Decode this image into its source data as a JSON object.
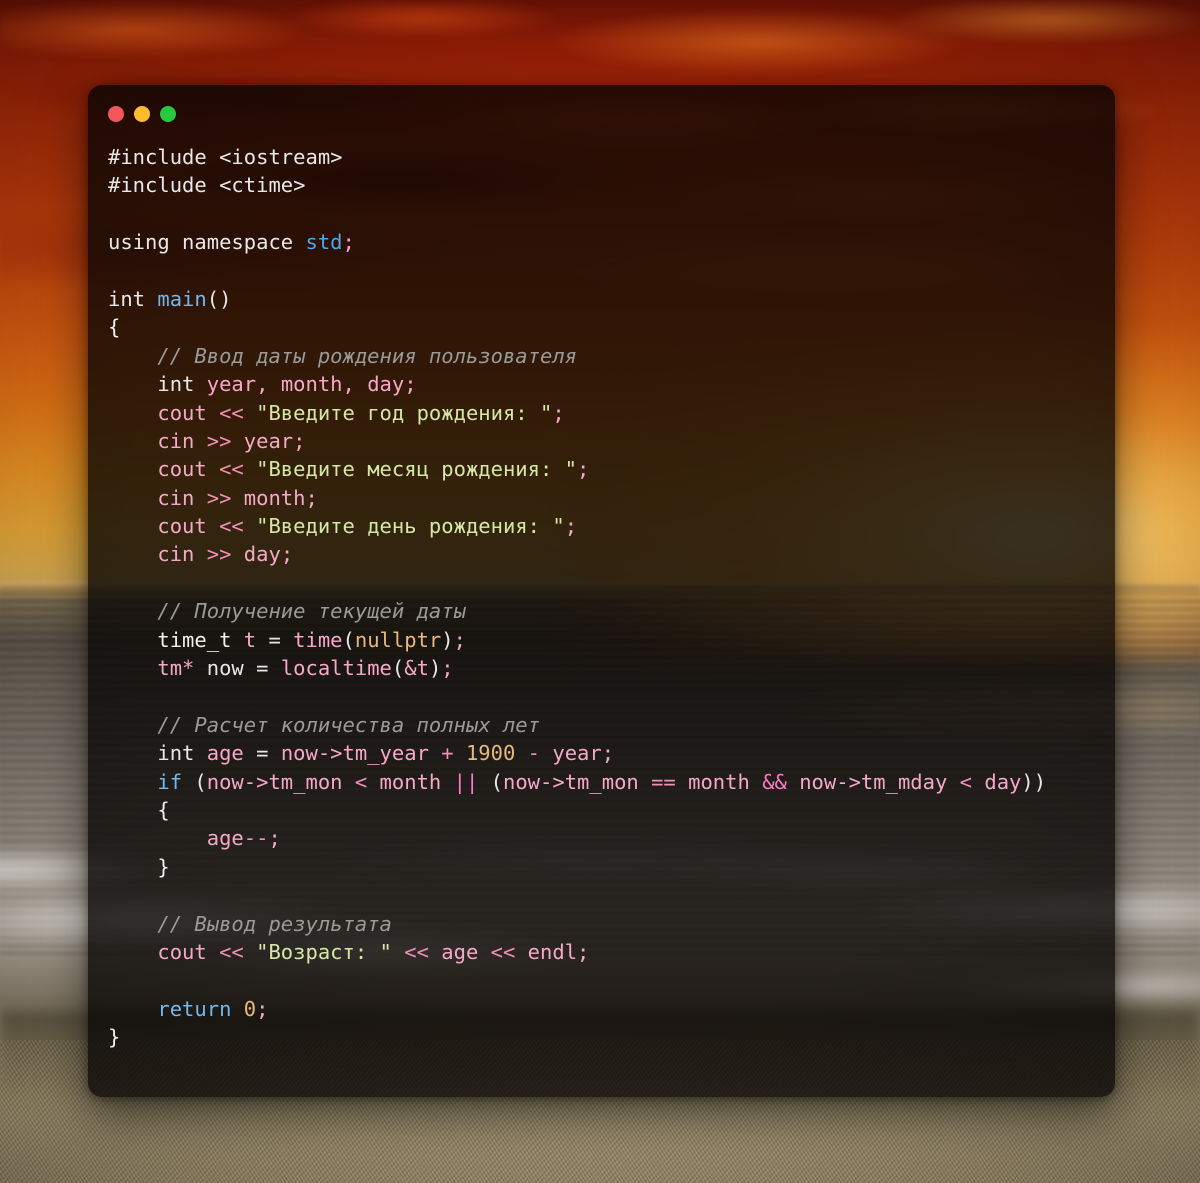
{
  "window": {
    "title": "",
    "traffic_lights": [
      {
        "name": "close",
        "color": "#f2575c"
      },
      {
        "name": "minimize",
        "color": "#fdbc2e"
      },
      {
        "name": "maximize",
        "color": "#28c840"
      }
    ]
  },
  "theme": {
    "background_color": "#080504",
    "plain": "#e8e8e8",
    "control_keyword": "#72b8ef",
    "namespace": "#4ea6ef",
    "function": "#6fb7ee",
    "variable": "#f7a8c8",
    "string": "#d7e8a6",
    "comment": "#9a9a9a",
    "number": "#e8b97a",
    "operator": "#f48fb8",
    "operator_bold": "#ff79c6"
  },
  "wallpaper": {
    "description": "sunset beach with red sky, ocean surf and sand",
    "sky_top_color": "#6b1205",
    "sky_glow_color": "#ffd27a",
    "sand_color": "#a4946d",
    "foam_color": "#f4f2ee"
  },
  "code": {
    "language": "C++",
    "lines": [
      "#include <iostream>",
      "#include <ctime>",
      "",
      "using namespace std;",
      "",
      "int main()",
      "{",
      "    // Ввод даты рождения пользователя",
      "    int year, month, day;",
      "    cout << \"Введите год рождения: \";",
      "    cin >> year;",
      "    cout << \"Введите месяц рождения: \";",
      "    cin >> month;",
      "    cout << \"Введите день рождения: \";",
      "    cin >> day;",
      "",
      "    // Получение текущей даты",
      "    time_t t = time(nullptr);",
      "    tm* now = localtime(&t);",
      "",
      "    // Расчет количества полных лет",
      "    int age = now->tm_year + 1900 - year;",
      "    if (now->tm_mon < month || (now->tm_mon == month && now->tm_mday < day))",
      "    {",
      "        age--;",
      "    }",
      "",
      "    // Вывод результата",
      "    cout << \"Возраст: \" << age << endl;",
      "",
      "    return 0;",
      "}"
    ],
    "tokens": [
      [
        {
          "c": "t-pre",
          "t": "#include "
        },
        {
          "c": "t-plain",
          "t": "<iostream>"
        }
      ],
      [
        {
          "c": "t-pre",
          "t": "#include "
        },
        {
          "c": "t-plain",
          "t": "<ctime>"
        }
      ],
      [],
      [
        {
          "c": "t-plain",
          "t": "using namespace "
        },
        {
          "c": "t-ns",
          "t": "std"
        },
        {
          "c": "t-punc",
          "t": ";"
        }
      ],
      [],
      [
        {
          "c": "t-plain",
          "t": "int "
        },
        {
          "c": "t-fn",
          "t": "main"
        },
        {
          "c": "t-plain",
          "t": "()"
        }
      ],
      [
        {
          "c": "t-brace",
          "t": "{"
        }
      ],
      [
        {
          "c": "t-cmt",
          "t": "    // Ввод даты рождения пользователя"
        }
      ],
      [
        {
          "c": "t-plain",
          "t": "    int "
        },
        {
          "c": "t-var",
          "t": "year"
        },
        {
          "c": "t-punc",
          "t": ", "
        },
        {
          "c": "t-var",
          "t": "month"
        },
        {
          "c": "t-punc",
          "t": ", "
        },
        {
          "c": "t-var",
          "t": "day"
        },
        {
          "c": "t-punc",
          "t": ";"
        }
      ],
      [
        {
          "c": "t-call",
          "t": "    cout "
        },
        {
          "c": "t-op",
          "t": "<< "
        },
        {
          "c": "t-str",
          "t": "\"Введите год рождения: \""
        },
        {
          "c": "t-punc",
          "t": ";"
        }
      ],
      [
        {
          "c": "t-call",
          "t": "    cin "
        },
        {
          "c": "t-op",
          "t": ">> "
        },
        {
          "c": "t-var",
          "t": "year"
        },
        {
          "c": "t-punc",
          "t": ";"
        }
      ],
      [
        {
          "c": "t-call",
          "t": "    cout "
        },
        {
          "c": "t-op",
          "t": "<< "
        },
        {
          "c": "t-str",
          "t": "\"Введите месяц рождения: \""
        },
        {
          "c": "t-punc",
          "t": ";"
        }
      ],
      [
        {
          "c": "t-call",
          "t": "    cin "
        },
        {
          "c": "t-op",
          "t": ">> "
        },
        {
          "c": "t-var",
          "t": "month"
        },
        {
          "c": "t-punc",
          "t": ";"
        }
      ],
      [
        {
          "c": "t-call",
          "t": "    cout "
        },
        {
          "c": "t-op",
          "t": "<< "
        },
        {
          "c": "t-str",
          "t": "\"Введите день рождения: \""
        },
        {
          "c": "t-punc",
          "t": ";"
        }
      ],
      [
        {
          "c": "t-call",
          "t": "    cin "
        },
        {
          "c": "t-op",
          "t": ">> "
        },
        {
          "c": "t-var",
          "t": "day"
        },
        {
          "c": "t-punc",
          "t": ";"
        }
      ],
      [],
      [
        {
          "c": "t-cmt",
          "t": "    // Получение текущей даты"
        }
      ],
      [
        {
          "c": "t-type",
          "t": "    time_t "
        },
        {
          "c": "t-var",
          "t": "t "
        },
        {
          "c": "t-plain",
          "t": "= "
        },
        {
          "c": "t-call",
          "t": "time"
        },
        {
          "c": "t-plain",
          "t": "("
        },
        {
          "c": "t-num",
          "t": "nullptr"
        },
        {
          "c": "t-plain",
          "t": ")"
        },
        {
          "c": "t-punc",
          "t": ";"
        }
      ],
      [
        {
          "c": "t-var",
          "t": "    tm* "
        },
        {
          "c": "t-plain",
          "t": "now = "
        },
        {
          "c": "t-call",
          "t": "localtime"
        },
        {
          "c": "t-plain",
          "t": "("
        },
        {
          "c": "t-var",
          "t": "&t"
        },
        {
          "c": "t-plain",
          "t": ")"
        },
        {
          "c": "t-punc",
          "t": ";"
        }
      ],
      [],
      [
        {
          "c": "t-cmt",
          "t": "    // Расчет количества полных лет"
        }
      ],
      [
        {
          "c": "t-plain",
          "t": "    int "
        },
        {
          "c": "t-var",
          "t": "age "
        },
        {
          "c": "t-plain",
          "t": "= "
        },
        {
          "c": "t-var",
          "t": "now->tm_year "
        },
        {
          "c": "t-op",
          "t": "+ "
        },
        {
          "c": "t-num",
          "t": "1900 "
        },
        {
          "c": "t-op",
          "t": "- "
        },
        {
          "c": "t-var",
          "t": "year"
        },
        {
          "c": "t-punc",
          "t": ";"
        }
      ],
      [
        {
          "c": "t-ctrl",
          "t": "    if "
        },
        {
          "c": "t-plain",
          "t": "("
        },
        {
          "c": "t-var",
          "t": "now->tm_mon "
        },
        {
          "c": "t-op",
          "t": "< "
        },
        {
          "c": "t-var",
          "t": "month "
        },
        {
          "c": "t-opb",
          "t": "|| "
        },
        {
          "c": "t-plain",
          "t": "("
        },
        {
          "c": "t-var",
          "t": "now->tm_mon "
        },
        {
          "c": "t-op",
          "t": "== "
        },
        {
          "c": "t-var",
          "t": "month "
        },
        {
          "c": "t-opb",
          "t": "&& "
        },
        {
          "c": "t-var",
          "t": "now->tm_mday "
        },
        {
          "c": "t-op",
          "t": "< "
        },
        {
          "c": "t-var",
          "t": "day"
        },
        {
          "c": "t-plain",
          "t": "))"
        }
      ],
      [
        {
          "c": "t-brace",
          "t": "    {"
        }
      ],
      [
        {
          "c": "t-var",
          "t": "        age"
        },
        {
          "c": "t-op",
          "t": "--"
        },
        {
          "c": "t-punc",
          "t": ";"
        }
      ],
      [
        {
          "c": "t-brace",
          "t": "    }"
        }
      ],
      [],
      [
        {
          "c": "t-cmt",
          "t": "    // Вывод результата"
        }
      ],
      [
        {
          "c": "t-call",
          "t": "    cout "
        },
        {
          "c": "t-op",
          "t": "<< "
        },
        {
          "c": "t-str",
          "t": "\"Возраст: \" "
        },
        {
          "c": "t-op",
          "t": "<< "
        },
        {
          "c": "t-var",
          "t": "age "
        },
        {
          "c": "t-op",
          "t": "<< "
        },
        {
          "c": "t-call",
          "t": "endl"
        },
        {
          "c": "t-punc",
          "t": ";"
        }
      ],
      [],
      [
        {
          "c": "t-ctrl",
          "t": "    return "
        },
        {
          "c": "t-num",
          "t": "0"
        },
        {
          "c": "t-punc",
          "t": ";"
        }
      ],
      [
        {
          "c": "t-brace",
          "t": "}"
        }
      ]
    ]
  }
}
